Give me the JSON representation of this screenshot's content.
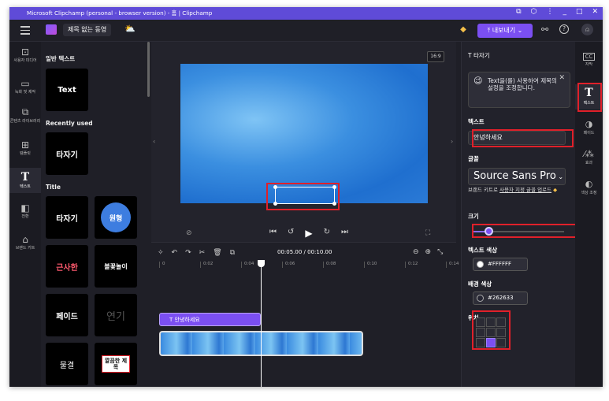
{
  "titlebar": {
    "title": "Microsoft Clipchamp (personal - browser version) - 홈 | Clipchamp"
  },
  "appbar": {
    "project_name": "제목 없는 동영",
    "export_label": "⤒ 내보내기 ⌄"
  },
  "leftnav": {
    "items": [
      {
        "icon": "folder-icon",
        "glyph": "⊡",
        "label": "사용자 미디어"
      },
      {
        "icon": "video-record-icon",
        "glyph": "▭",
        "label": "녹화 및 제작"
      },
      {
        "icon": "content-library-icon",
        "glyph": "⧉",
        "label": "콘텐츠 라이브러리"
      },
      {
        "icon": "templates-icon",
        "glyph": "⊞",
        "label": "템플릿"
      },
      {
        "icon": "text-icon",
        "glyph": "T",
        "label": "텍스트"
      },
      {
        "icon": "transitions-icon",
        "glyph": "◧",
        "label": "전환"
      },
      {
        "icon": "brand-kit-icon",
        "glyph": "⌂",
        "label": "브랜드 키트"
      }
    ]
  },
  "textpanel": {
    "section_plain": "일반 텍스트",
    "section_recent": "Recently used",
    "section_title": "Title",
    "tiles": {
      "plain_text": "Text",
      "recent_typewriter": "타자기",
      "title_typewriter": "타자기",
      "title_circle": "원형",
      "title_fancy": "근사한",
      "title_bubble": "볼꽃놀이",
      "title_fade": "페이드",
      "title_smoke": "연기",
      "title_wave": "물결",
      "title_clean": "깔끔한 제목"
    }
  },
  "preview": {
    "aspect_ratio": "16:9"
  },
  "timeline": {
    "time_display": "00:05.00 / 00:10.00",
    "ticks": [
      "0",
      "0:02",
      "0:04",
      "0:06",
      "0:08",
      "0:10",
      "0:12",
      "0:14"
    ],
    "text_clip_label": "T  안녕하세요"
  },
  "props": {
    "header": "T  타자기",
    "tip_text": "Text을(를) 사용하여 제목의 설정을 조정합니다.",
    "text_label": "텍스트",
    "text_value": "안녕하세요",
    "font_label": "글꼴",
    "font_value": "Source Sans Pro",
    "font_link_prefix": "브랜드 키트로 ",
    "font_link": "사용자 지정 글꼴 업로드",
    "size_label": "크기",
    "size_value": 0.18,
    "text_color_label": "텍스트 색상",
    "text_color_value": "#FFFFFF",
    "bg_color_label": "배경 색상",
    "bg_color_value": "#262633",
    "position_label": "위치",
    "position_selected": 7
  },
  "rightnav": {
    "items": [
      {
        "icon": "captions-icon",
        "glyph": "CC",
        "label": "자막"
      },
      {
        "icon": "text-icon",
        "glyph": "T",
        "label": "텍스트"
      },
      {
        "icon": "fade-icon",
        "glyph": "◑",
        "label": "페이드"
      },
      {
        "icon": "effects-icon",
        "glyph": "⁄⁂",
        "label": "효과"
      },
      {
        "icon": "color-adjust-icon",
        "glyph": "◐",
        "label": "색상 조정"
      }
    ]
  },
  "colors": {
    "titlebar": "#5f4bd8",
    "accent": "#7b4ff2",
    "highlight": "#e0202a"
  }
}
